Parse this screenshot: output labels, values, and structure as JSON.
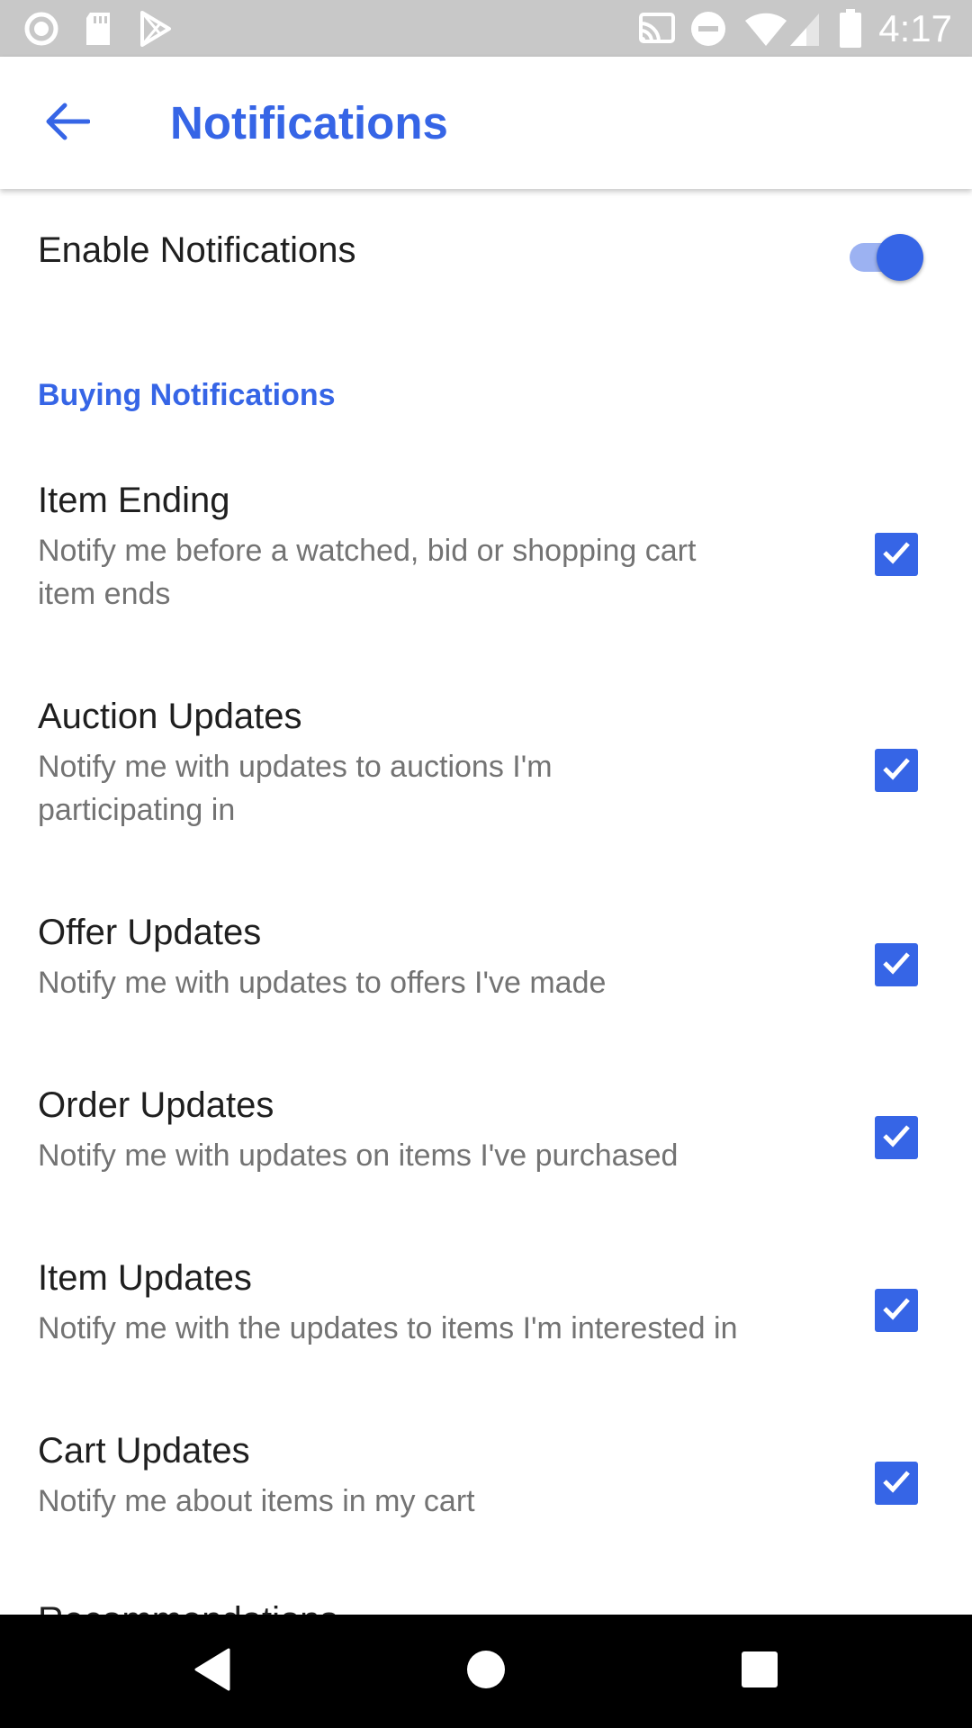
{
  "status_bar": {
    "time": "4:17",
    "left_icons": [
      "circle-app-icon",
      "sd-card-icon",
      "play-store-icon"
    ],
    "right_icons": [
      "cast-icon",
      "do-not-disturb-icon",
      "wifi-icon",
      "signal-icon",
      "battery-icon"
    ]
  },
  "app_bar": {
    "title": "Notifications",
    "back_icon": "back-arrow-icon"
  },
  "enable": {
    "label": "Enable Notifications",
    "enabled": true
  },
  "section": {
    "title": "Buying Notifications"
  },
  "items": [
    {
      "title": "Item Ending",
      "desc": "Notify me before a watched, bid or shopping cart item ends",
      "checked": true
    },
    {
      "title": "Auction Updates",
      "desc": "Notify me with updates to auctions I'm participating in",
      "checked": true
    },
    {
      "title": "Offer Updates",
      "desc": "Notify me with updates to offers I've made",
      "checked": true
    },
    {
      "title": "Order Updates",
      "desc": "Notify me with updates on items I've purchased",
      "checked": true
    },
    {
      "title": "Item Updates",
      "desc": "Notify me with the updates to items I'm interested in",
      "checked": true
    },
    {
      "title": "Cart Updates",
      "desc": "Notify me about items in my cart",
      "checked": true
    }
  ],
  "partial_item": {
    "title": "Recommendations"
  },
  "nav_bar": {
    "buttons": [
      "back-triangle-icon",
      "home-circle-icon",
      "recents-square-icon"
    ]
  },
  "colors": {
    "accent": "#3665e6",
    "status_bar": "#c8c8c8",
    "nav_bar": "#000000"
  }
}
